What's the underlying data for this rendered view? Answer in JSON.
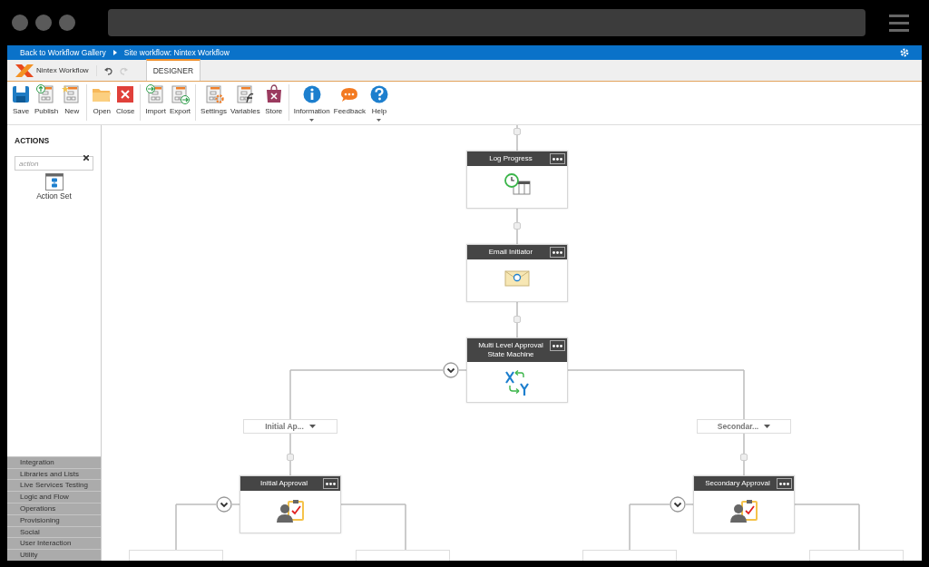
{
  "breadcrumb": [
    "Back to Workflow Gallery",
    "Site workflow: Nintex Workflow"
  ],
  "app": {
    "logo_text": "Nintex Workflow",
    "undo": {
      "disabled": false
    },
    "redo": {
      "disabled": true
    }
  },
  "tabs": [
    {
      "label": "DESIGNER",
      "selected": true
    }
  ],
  "ribbon": {
    "groups": [
      {
        "buttons": [
          {
            "label": "Save",
            "dropdown": false
          },
          {
            "label": "Publish",
            "dropdown": false
          },
          {
            "label": "New",
            "dropdown": false
          }
        ]
      },
      {
        "buttons": [
          {
            "label": "Open",
            "dropdown": false
          },
          {
            "label": "Close",
            "dropdown": false
          }
        ]
      },
      {
        "buttons": [
          {
            "label": "Import",
            "dropdown": false
          },
          {
            "label": "Export",
            "dropdown": false
          }
        ]
      },
      {
        "buttons": [
          {
            "label": "Settings",
            "dropdown": false
          },
          {
            "label": "Variables",
            "dropdown": false
          },
          {
            "label": "Store",
            "dropdown": false
          }
        ]
      },
      {
        "buttons": [
          {
            "label": "Information",
            "dropdown": true
          },
          {
            "label": "Feedback",
            "dropdown": false
          },
          {
            "label": "Help",
            "dropdown": true
          }
        ]
      }
    ]
  },
  "sidebar": {
    "title": "ACTIONS",
    "search": {
      "value": "action"
    },
    "items": [
      {
        "label": "Action Set"
      }
    ],
    "categories": [
      {
        "label": "Integration"
      },
      {
        "label": "Libraries and Lists"
      },
      {
        "label": "Live Services Testing"
      },
      {
        "label": "Logic and Flow"
      },
      {
        "label": "Operations"
      },
      {
        "label": "Provisioning"
      },
      {
        "label": "Social"
      },
      {
        "label": "User Interaction"
      },
      {
        "label": "Utility"
      }
    ]
  },
  "canvas": {
    "nodes": [
      {
        "title": "Log Progress",
        "kind": "log"
      },
      {
        "title": "Email Initiator",
        "kind": "email"
      },
      {
        "title": "Multi Level Approval State Machine",
        "kind": "state-machine"
      }
    ],
    "branches": [
      {
        "label": "Initial Ap...",
        "node": {
          "title": "Initial Approval",
          "kind": "approval"
        }
      },
      {
        "label": "Secondar...",
        "node": {
          "title": "Secondary Approval",
          "kind": "approval"
        }
      }
    ]
  }
}
